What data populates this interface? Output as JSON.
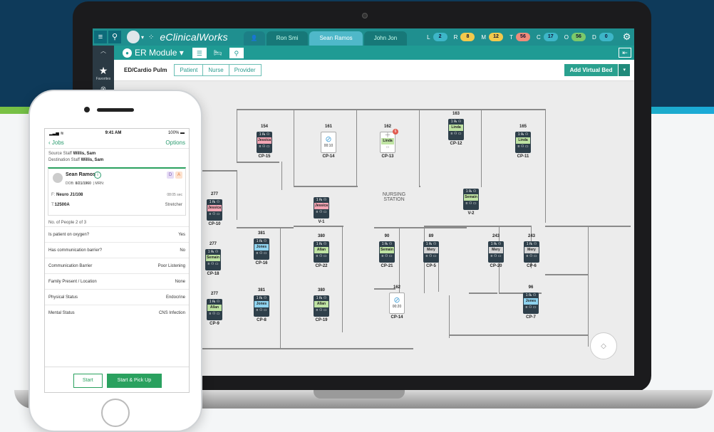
{
  "colors": {
    "teal": "#1f8f8f",
    "green": "#2aa15f",
    "navy": "#0e3a5a"
  },
  "app": {
    "brand": "eClinicalWorks",
    "tabs": [
      {
        "label": "Ron Smi",
        "active": false
      },
      {
        "label": "Sean Ramos",
        "active": true
      },
      {
        "label": "John Jon",
        "active": false
      }
    ],
    "counters": [
      {
        "letter": "L",
        "value": "2",
        "color": "#3db6c8"
      },
      {
        "letter": "R",
        "value": "8",
        "color": "#f2c94c"
      },
      {
        "letter": "M",
        "value": "12",
        "color": "#f2c94c"
      },
      {
        "letter": "T",
        "value": "56",
        "color": "#f08b7a"
      },
      {
        "letter": "C",
        "value": "17",
        "color": "#3db6c8"
      },
      {
        "letter": "O",
        "value": "56",
        "color": "#7cc96a"
      },
      {
        "letter": "D",
        "value": "0",
        "color": "#3db6c8"
      }
    ],
    "module_title": "ER Module",
    "rail_favorites": "Favorites"
  },
  "sub": {
    "title": "ED/Cardio Pulm",
    "segments": [
      "Patient",
      "Nurse",
      "Provider"
    ],
    "add_bed": "Add Virtual Bed"
  },
  "floor": {
    "nursing_station": "NURSING\nSTATION",
    "beds": [
      {
        "room": "154",
        "name": "Jessica",
        "bed": "CP-15",
        "tag": "#f3a6b4"
      },
      {
        "room": "161",
        "name": "",
        "bed": "CP-14",
        "time": "00:10"
      },
      {
        "room": "162",
        "name": "Linda",
        "bed": "CP-13",
        "badge": "6"
      },
      {
        "room": "163",
        "name": "Linda",
        "bed": "CP-12",
        "tag": "#bfe3a3"
      },
      {
        "room": "165",
        "name": "Linda",
        "bed": "CP-11",
        "tag": "#bfe3a3"
      },
      {
        "room": "277",
        "name": "Jessica",
        "bed": "CP-10",
        "tag": "#f3a6b4"
      },
      {
        "room": "",
        "name": "Jessica",
        "bed": "V-1",
        "tag": "#f3a6b4"
      },
      {
        "room": "",
        "name": "Semain",
        "bed": "V-2",
        "tag": "#bfe3a3"
      },
      {
        "room": "277",
        "name": "Semain",
        "bed": "CP-18",
        "tag": "#bfe3a3"
      },
      {
        "room": "381",
        "name": "Jones",
        "bed": "CP-16",
        "tag": "#8fd3ef"
      },
      {
        "room": "380",
        "name": "Allan",
        "bed": "CP-22",
        "tag": "#bfe3a3"
      },
      {
        "room": "90",
        "name": "Semain",
        "bed": "CP-21",
        "tag": "#bfe3a3"
      },
      {
        "room": "89",
        "name": "Mery",
        "bed": "CP-5",
        "tag": "#d6d6d6"
      },
      {
        "room": "243",
        "name": "Mery",
        "bed": "CP-20",
        "tag": "#d6d6d6"
      },
      {
        "room": "243",
        "name": "Mery",
        "bed": "CP-6",
        "tag": "#d6d6d6"
      },
      {
        "room": "277",
        "name": "Allan",
        "bed": "CP-9",
        "tag": "#bfe3a3"
      },
      {
        "room": "381",
        "name": "Jones",
        "bed": "CP-8",
        "tag": "#8fd3ef"
      },
      {
        "room": "380",
        "name": "Allan",
        "bed": "CP-19",
        "tag": "#bfe3a3"
      },
      {
        "room": "162",
        "name": "Linda",
        "bed": "CP-14",
        "time": "00:20"
      },
      {
        "room": "96",
        "name": "Jones",
        "bed": "CP-7",
        "tag": "#8fd3ef"
      }
    ]
  },
  "phone": {
    "time": "9:41 AM",
    "battery": "100%",
    "back": "Jobs",
    "options": "Options",
    "source_label": "Source Staff",
    "source": "Willis, Sam",
    "dest_label": "Destination Staff",
    "dest": "Willis, Sam",
    "patient": {
      "name": "Sean Ramos",
      "dob_label": "DOB:",
      "dob": "8/21/1960",
      "mrn_label": "MRN:",
      "badge_d": "D",
      "badge_a": "A",
      "location_label": "F:",
      "location": "Neuro J1/108",
      "elapsed": "08:05 sec",
      "id_label": "T:",
      "id": "12500A",
      "transport": "Stretcher"
    },
    "people": "No. of People 2 of 3",
    "questions": [
      {
        "q": "Is patient on oxygen?",
        "a": "Yes"
      },
      {
        "q": "Has communication barrier?",
        "a": "No"
      },
      {
        "q": "Communication Barrier",
        "a": "Poor Listening"
      },
      {
        "q": "Family Present / Location",
        "a": "None"
      },
      {
        "q": "Physical Status",
        "a": "Endocrine"
      },
      {
        "q": "Mental Status",
        "a": "CNS Infection"
      }
    ],
    "start": "Start",
    "start_pickup": "Start & Pick Up"
  }
}
